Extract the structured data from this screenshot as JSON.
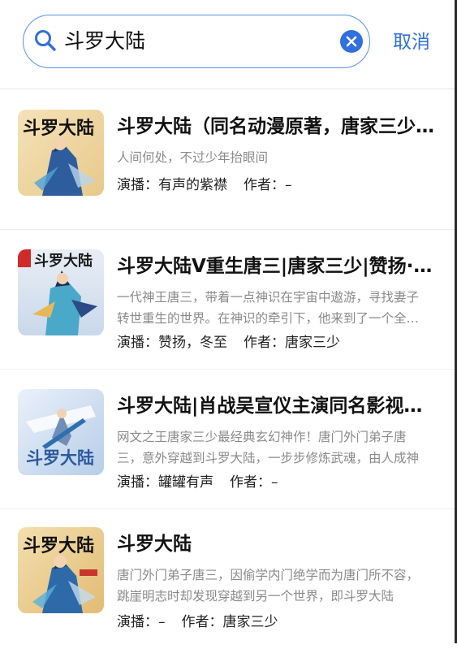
{
  "search": {
    "query": "斗罗大陆",
    "cancel_label": "取消"
  },
  "results": [
    {
      "title": "斗罗大陆（同名动漫原著，唐家三少原著)",
      "desc": "人间何处，不过少年抬眼间",
      "narrator_label": "演播：有声的紫襟",
      "author_label": "作者：–",
      "cover_text": "斗罗大陆"
    },
    {
      "title": "斗罗大陆V重生唐三|唐家三少|赞扬·冬至",
      "desc": "一代神王唐三，带着一点神识在宇宙中遨游，寻找妻子转世重生的世界。在神识的牵引下，他来到了一个全新的世界",
      "narrator_label": "演播：赞扬，冬至",
      "author_label": "作者：唐家三少",
      "cover_text": "斗罗大陆"
    },
    {
      "title": "斗罗大陆|肖战吴宣仪主演同名影视剧原著",
      "desc": "网文之王唐家三少最经典玄幻神作！唐门外门弟子唐三，意外穿越到斗罗大陆，一步步修炼武魂，由人成神",
      "narrator_label": "演播：罐罐有声",
      "author_label": "作者：–",
      "cover_text": "斗罗大陆"
    },
    {
      "title": "斗罗大陆",
      "desc": "唐门外门弟子唐三，因偷学内门绝学而为唐门所不容，跳崖明志时却发现穿越到另一个世界，即斗罗大陆",
      "narrator_label": "演播：–",
      "author_label": "作者：唐家三少",
      "cover_text": "斗罗大陆"
    }
  ],
  "colors": {
    "accent": "#2f6fe0",
    "desc": "#8a8a8a"
  }
}
